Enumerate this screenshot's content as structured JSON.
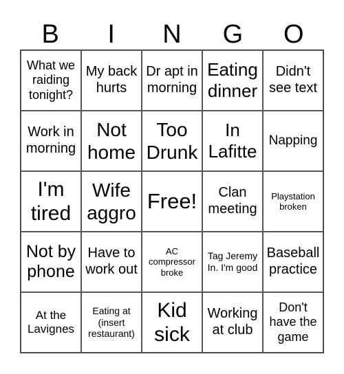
{
  "header": [
    "B",
    "I",
    "N",
    "G",
    "O"
  ],
  "cells": [
    "What we raiding tonight?",
    "My back hurts",
    "Dr apt in morning",
    "Eating dinner",
    "Didn't see text",
    "Work in morning",
    "Not home",
    "Too Drunk",
    "In Lafitte",
    "Napping",
    "I'm tired",
    "Wife aggro",
    "Free!",
    "Clan meeting",
    "Playstation broken",
    "Not by phone",
    "Have to work out",
    "AC compressor broke",
    "Tag Jeremy In. I'm good",
    "Baseball practice",
    "At the Lavignes",
    "Eating at (insert restaurant)",
    "Kid sick",
    "Working at club",
    "Don't have the game"
  ]
}
